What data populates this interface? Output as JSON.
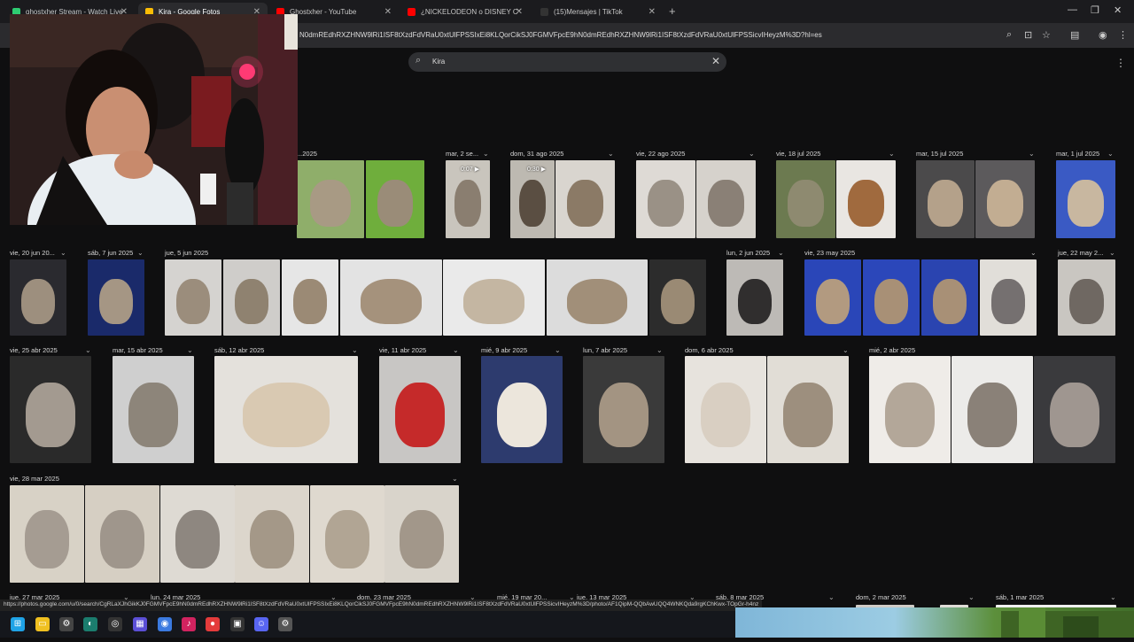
{
  "browser": {
    "tabs": [
      {
        "label": "ghostxher Stream - Watch Live",
        "fav": "#2ecc71"
      },
      {
        "label": "Kira - Google Fotos",
        "fav": "#fbbc05"
      },
      {
        "label": "Ghostxher - YouTube",
        "fav": "#ff0000"
      },
      {
        "label": "¿NICKELODEON o DISNEY CHA",
        "fav": "#ff0000"
      },
      {
        "label": "(15)Mensajes | TikTok",
        "fav": "#333333"
      }
    ],
    "url": "N0dmREdhRXZHNW9lRi1ISF8tXzdFdVRaU0xtUlFPSSIxEi8KLQorCikSJ0FGMVFpcE9hN0dmREdhRXZHNW9lRi1ISF8tXzdFdVRaU0xtUlFPSSicvIHeyzM%3D?hl=es"
  },
  "search": {
    "value": "Kira"
  },
  "date_headers": [
    {
      "label": "...2025",
      "row": 0
    },
    {
      "label": "mar, 2 se...",
      "row": 0
    },
    {
      "label": "dom, 31 ago 2025",
      "row": 0
    },
    {
      "label": "vie, 22 ago 2025",
      "row": 0
    },
    {
      "label": "vie, 18 jul 2025",
      "row": 0
    },
    {
      "label": "mar, 15 jul 2025",
      "row": 0
    },
    {
      "label": "mar, 1 jul 2025",
      "row": 0
    },
    {
      "label": "vie, 20 jun 20...",
      "row": 1
    },
    {
      "label": "sáb, 7 jun 2025",
      "row": 1
    },
    {
      "label": "jue, 5 jun 2025",
      "row": 1
    },
    {
      "label": "lun, 2 jun 2025",
      "row": 1
    },
    {
      "label": "vie, 23 may 2025",
      "row": 1
    },
    {
      "label": "jue, 22 may 2...",
      "row": 1
    },
    {
      "label": "vie, 25 abr 2025",
      "row": 2
    },
    {
      "label": "mar, 15 abr 2025",
      "row": 2
    },
    {
      "label": "sáb, 12 abr 2025",
      "row": 2
    },
    {
      "label": "vie, 11 abr 2025",
      "row": 2
    },
    {
      "label": "mié, 9 abr 2025",
      "row": 2
    },
    {
      "label": "lun, 7 abr 2025",
      "row": 2
    },
    {
      "label": "dom, 6 abr 2025",
      "row": 2
    },
    {
      "label": "mié, 2 abr 2025",
      "row": 2
    },
    {
      "label": "vie, 28 mar 2025",
      "row": 3
    },
    {
      "label": "jue, 27 mar 2025",
      "row": 4
    },
    {
      "label": "lun, 24 mar 2025",
      "row": 4
    },
    {
      "label": "dom, 23 mar 2025",
      "row": 4
    },
    {
      "label": "mié, 19 mar 20...",
      "row": 4
    },
    {
      "label": "jue, 13 mar 2025",
      "row": 4
    },
    {
      "label": "sáb, 8 mar 2025",
      "row": 4
    },
    {
      "label": "dom, 2 mar 2025",
      "row": 4
    },
    {
      "label": "sáb, 1 mar 2025",
      "row": 4
    }
  ],
  "video_badges": [
    "0:07",
    "0:30"
  ],
  "status_url": "https://photos.google.com/u/0/search/CgRLaXJhGikKJ0FGMVFpcE9hN0dmREdhRXZHNW9lRi1ISF8tXzdFdVRaU0xtUlFPSSIxEi8KLQorCikSJ0FGMVFpcE9hN0dmREdhRXZHNW9lRi1ISF8tXzdFdVRaU0xtUlFPSSicvIHeyzM%3D/photo/AF1QipM-QQbAwUQQ4WNKQda9rgKChKwx-TOpGr-h4nz",
  "icons": [
    "search-icon",
    "close-icon",
    "more-vert-icon",
    "zoom-icon",
    "star-icon",
    "windows-start-icon"
  ],
  "colors": {
    "background": "#0f0f10",
    "tabbar": "#1b1b1e",
    "search": "#2f3033"
  }
}
